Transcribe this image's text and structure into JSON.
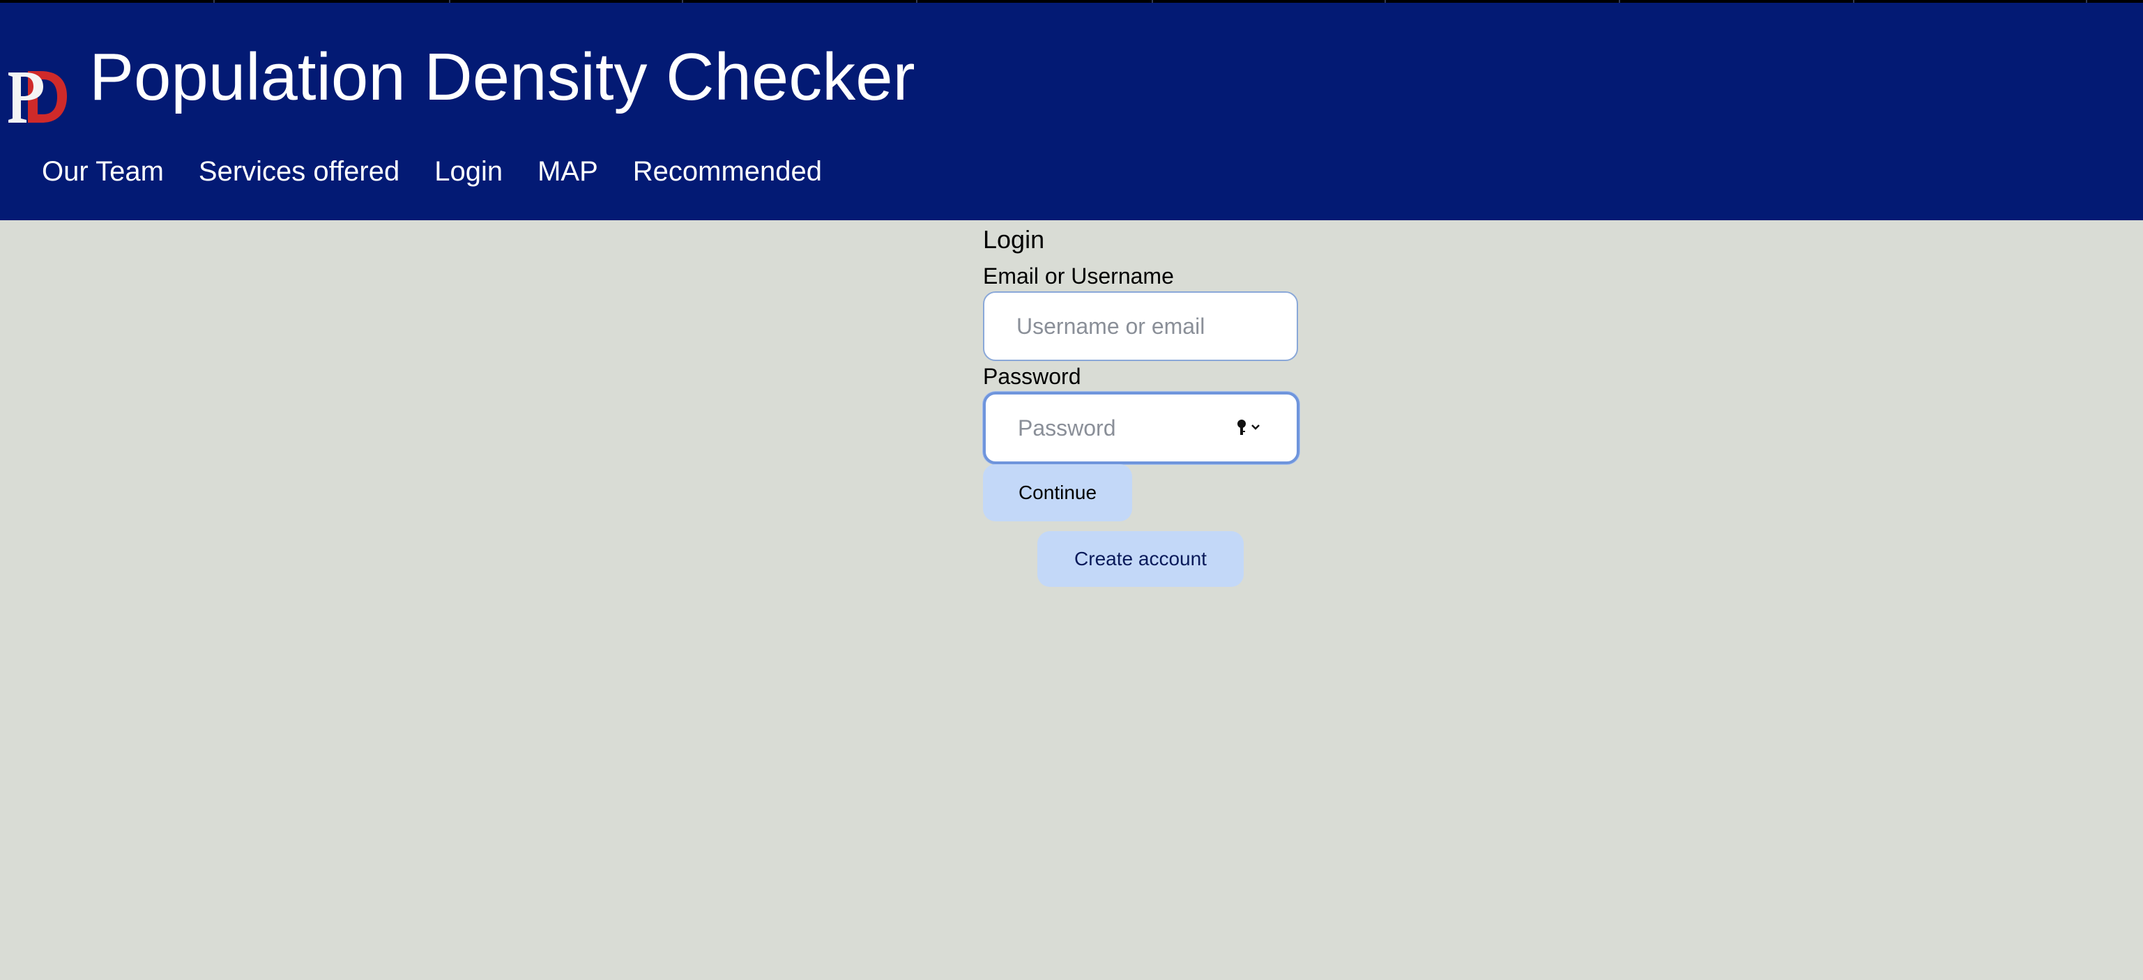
{
  "header": {
    "title": "Population Density Checker",
    "logo_icon": "pd-logo-icon",
    "background_color": "#031a74"
  },
  "nav": {
    "items": [
      {
        "label": "Our Team"
      },
      {
        "label": "Services offered"
      },
      {
        "label": "Login"
      },
      {
        "label": "MAP"
      },
      {
        "label": "Recommended"
      }
    ]
  },
  "login": {
    "title": "Login",
    "email_label": "Email or Username",
    "email_placeholder": "Username or email",
    "email_value": "",
    "password_label": "Password",
    "password_placeholder": "Password",
    "password_value": "",
    "password_manager_icon": "key-icon",
    "continue_label": "Continue",
    "create_account_label": "Create account",
    "button_color": "#c3d8f8"
  },
  "page": {
    "background_color": "#d9dcd5"
  }
}
